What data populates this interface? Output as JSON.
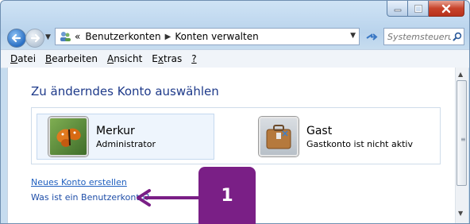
{
  "window": {
    "buttons": {
      "minimize": "minimize",
      "maximize": "maximize",
      "close": "close"
    }
  },
  "address_bar": {
    "prefix": "«",
    "crumbs": [
      "Benutzerkonten",
      "Konten verwalten"
    ]
  },
  "search": {
    "placeholder": "Systemsteuerung durc..."
  },
  "menu": {
    "items": [
      {
        "label": "Datei",
        "accel": "D"
      },
      {
        "label": "Bearbeiten",
        "accel": "B"
      },
      {
        "label": "Ansicht",
        "accel": "A"
      },
      {
        "label": "Extras",
        "accel": "x"
      },
      {
        "label": "?",
        "accel": "?"
      }
    ]
  },
  "main": {
    "heading": "Zu änderndes Konto auswählen",
    "accounts": [
      {
        "name": "Merkur",
        "role": "Administrator",
        "picture": "butterfly-picture"
      },
      {
        "name": "Gast",
        "role": "Gastkonto ist nicht aktiv",
        "picture": "suitcase-picture"
      }
    ],
    "links": {
      "new_account": "Neues Konto erstellen",
      "what_is": "Was ist ein Benutzerkonto?"
    }
  },
  "callout": {
    "number": "1",
    "color": "#7a1f86"
  },
  "colors": {
    "heading": "#1e3a8a",
    "link": "#1f5fbf",
    "callout": "#7a1f86"
  }
}
